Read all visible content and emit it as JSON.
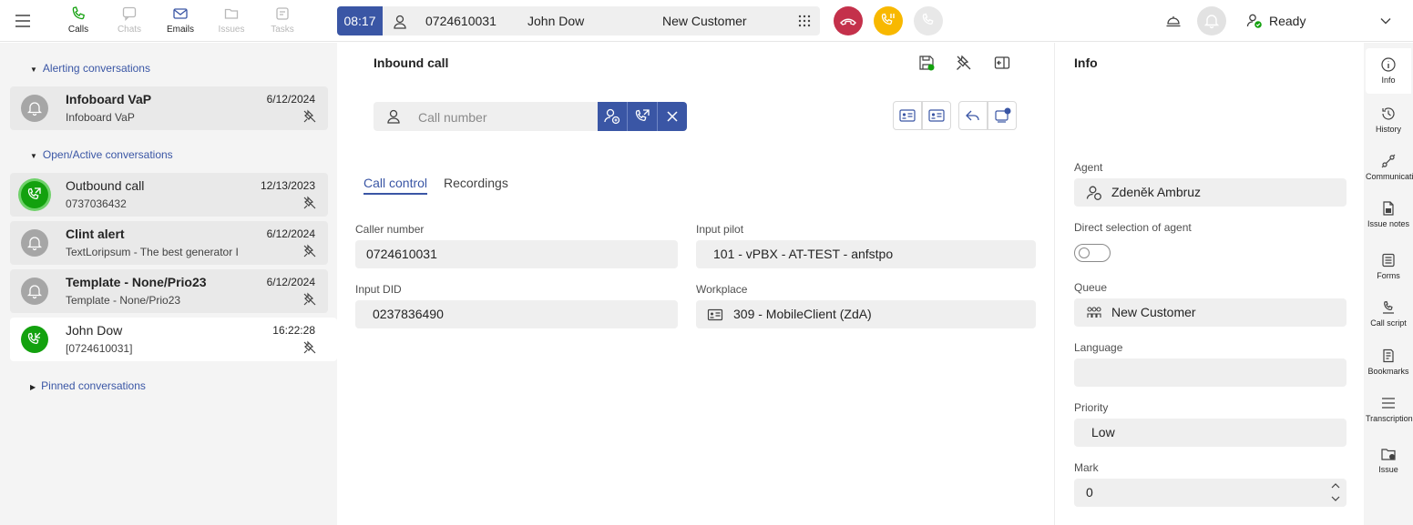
{
  "nav": {
    "items": [
      {
        "label": "Calls",
        "icon": "phone-icon",
        "active": true
      },
      {
        "label": "Chats",
        "icon": "chat-icon",
        "active": false
      },
      {
        "label": "Emails",
        "icon": "mail-icon",
        "active": true
      },
      {
        "label": "Issues",
        "icon": "folder-icon",
        "active": false
      },
      {
        "label": "Tasks",
        "icon": "tasks-icon",
        "active": false
      }
    ]
  },
  "callbar": {
    "timer": "08:17",
    "number": "0724610031",
    "name": "John Dow",
    "queue": "New Customer"
  },
  "status": {
    "label": "Ready"
  },
  "sidebar": {
    "alerting_header": "Alerting conversations",
    "open_header": "Open/Active conversations",
    "pinned_header": "Pinned conversations",
    "alerting": [
      {
        "title": "Infoboard VaP",
        "subtitle": "Infoboard VaP",
        "date": "6/12/2024"
      }
    ],
    "open": [
      {
        "title": "Outbound call",
        "subtitle": "0737036432",
        "date": "12/13/2023"
      },
      {
        "title": "Clint alert",
        "subtitle": "TextLoripsum - The best generator I",
        "date": "6/12/2024"
      },
      {
        "title": "Template - None/Prio23",
        "subtitle": "Template - None/Prio23",
        "date": "6/12/2024"
      },
      {
        "title": "John Dow",
        "subtitle": "[0724610031]",
        "date": "16:22:28"
      }
    ]
  },
  "main": {
    "title": "Inbound call",
    "call_number_placeholder": "Call number",
    "tabs": [
      "Call control",
      "Recordings"
    ],
    "fields": {
      "caller_number_label": "Caller number",
      "caller_number": "0724610031",
      "input_pilot_label": "Input pilot",
      "input_pilot": "101 - vPBX - AT-TEST - anfstpo",
      "input_did_label": "Input DID",
      "input_did": "0237836490",
      "workplace_label": "Workplace",
      "workplace": "309 - MobileClient (ZdA)"
    }
  },
  "info": {
    "title": "Info",
    "agent_label": "Agent",
    "agent": "Zdeněk Ambruz",
    "direct_label": "Direct selection of agent",
    "queue_label": "Queue",
    "queue": "New Customer",
    "language_label": "Language",
    "language": "",
    "priority_label": "Priority",
    "priority": "Low",
    "mark_label": "Mark",
    "mark": "0"
  },
  "rail": {
    "items": [
      {
        "label": "Info",
        "icon": "info-icon"
      },
      {
        "label": "History",
        "icon": "history-icon"
      },
      {
        "label": "Communications",
        "icon": "communications-icon"
      },
      {
        "label": "Issue notes",
        "icon": "issue-notes-icon"
      },
      {
        "label": "Forms",
        "icon": "forms-icon"
      },
      {
        "label": "Call script",
        "icon": "call-script-icon"
      },
      {
        "label": "Bookmarks",
        "icon": "bookmarks-icon"
      },
      {
        "label": "Transcription",
        "icon": "transcription-icon"
      },
      {
        "label": "Issue",
        "icon": "issue-icon"
      }
    ]
  },
  "colors": {
    "accent": "#3a56a5",
    "hangup": "#c4314b",
    "hold": "#f8b800",
    "active_call": "#13a10e"
  }
}
